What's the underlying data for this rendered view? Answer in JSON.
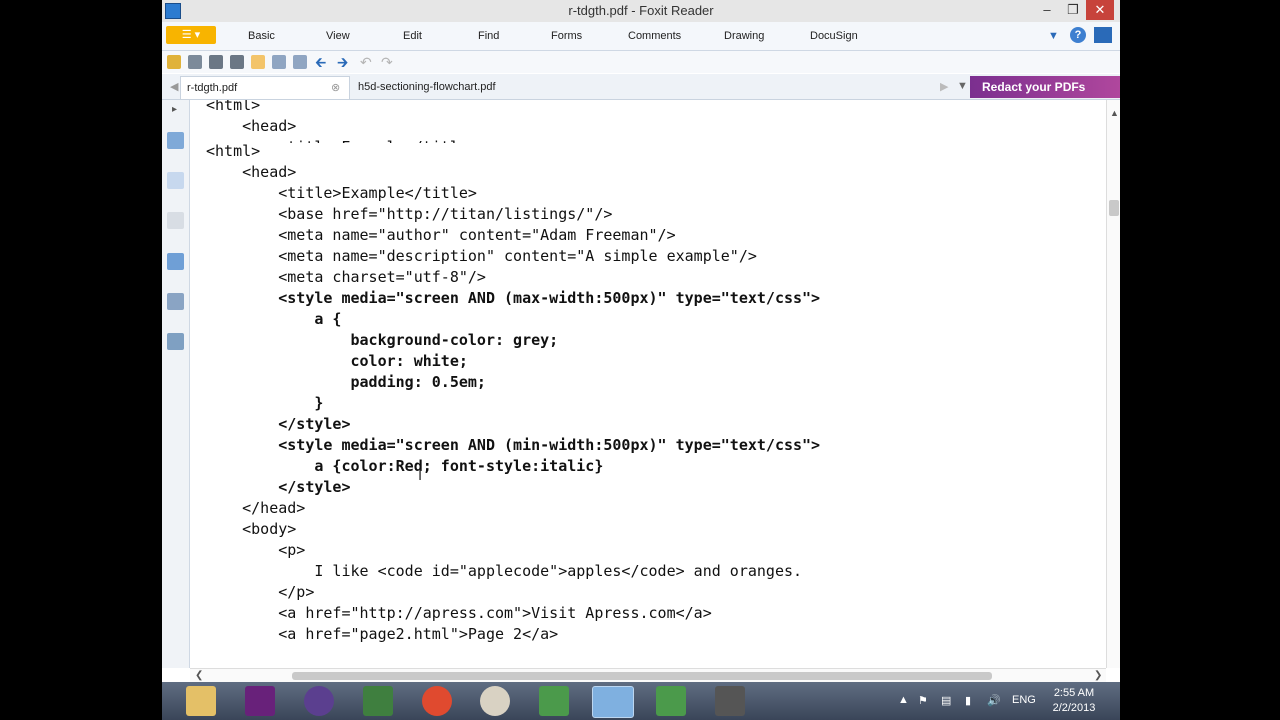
{
  "window": {
    "title": "r-tdgth.pdf - Foxit Reader"
  },
  "menubar": {
    "items": [
      {
        "label": "Basic"
      },
      {
        "label": "View"
      },
      {
        "label": "Edit"
      },
      {
        "label": "Find"
      },
      {
        "label": "Forms"
      },
      {
        "label": "Comments"
      },
      {
        "label": "Drawing"
      },
      {
        "label": "DocuSign"
      }
    ]
  },
  "tabs": [
    {
      "label": "r-tdgth.pdf"
    },
    {
      "label": "h5d-sectioning-flowchart.pdf"
    }
  ],
  "ad": {
    "label": "Redact your PDFs"
  },
  "code": {
    "top_partial": [
      "<html>",
      "    <head>",
      "        <title>Example</title>"
    ],
    "lines": [
      {
        "text": "<html>",
        "bold": false
      },
      {
        "text": "    <head>",
        "bold": false
      },
      {
        "text": "        <title>Example</title>",
        "bold": false
      },
      {
        "text": "        <base href=\"http://titan/listings/\"/>",
        "bold": false
      },
      {
        "text": "        <meta name=\"author\" content=\"Adam Freeman\"/>",
        "bold": false
      },
      {
        "text": "        <meta name=\"description\" content=\"A simple example\"/>",
        "bold": false
      },
      {
        "text": "        <meta charset=\"utf-8\"/>",
        "bold": false
      },
      {
        "text": "        <style media=\"screen AND (max-width:500px)\" type=\"text/css\">",
        "bold": true
      },
      {
        "text": "            a {",
        "bold": true
      },
      {
        "text": "                background-color: grey;",
        "bold": true
      },
      {
        "text": "                color: white;",
        "bold": true
      },
      {
        "text": "                padding: 0.5em;",
        "bold": true
      },
      {
        "text": "            }",
        "bold": true
      },
      {
        "text": "        </style>",
        "bold": true
      },
      {
        "text": "        <style media=\"screen AND (min-width:500px)\" type=\"text/css\">",
        "bold": true
      },
      {
        "text": "            a {color:Red; font-style:italic}",
        "bold": true
      },
      {
        "text": "        </style>",
        "bold": true
      },
      {
        "text": "    </head>",
        "bold": false
      },
      {
        "text": "    <body>",
        "bold": false
      },
      {
        "text": "        <p>",
        "bold": false
      },
      {
        "text": "            I like <code id=\"applecode\">apples</code> and oranges.",
        "bold": false
      },
      {
        "text": "        </p>",
        "bold": false
      },
      {
        "text": "        <a href=\"http://apress.com\">Visit Apress.com</a>",
        "bold": false
      },
      {
        "text": "        <a href=\"page2.html\">Page 2</a>",
        "bold": false
      }
    ]
  },
  "taskbar": {
    "language": "ENG",
    "time": "2:55 AM",
    "date": "2/2/2013"
  }
}
